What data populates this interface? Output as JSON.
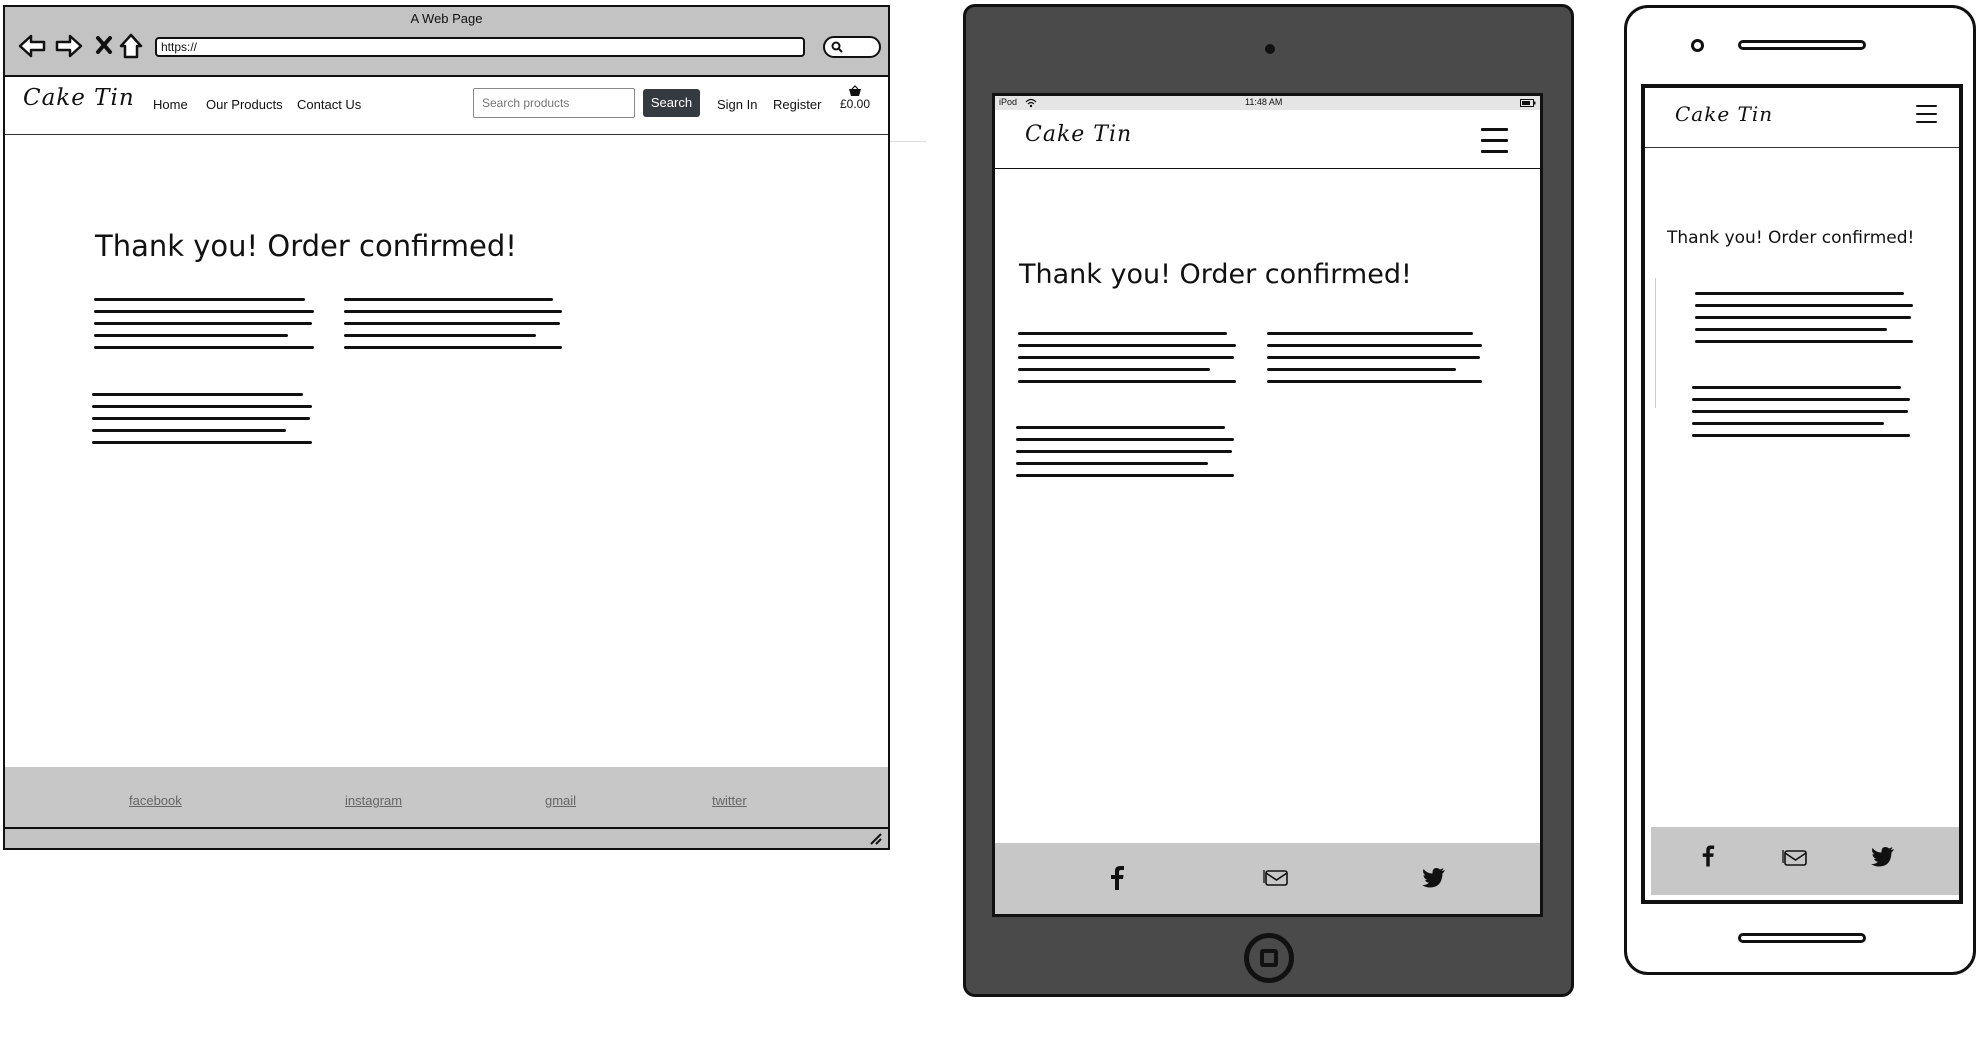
{
  "desktop": {
    "window_title": "A Web Page",
    "url": "https://",
    "brand": "Cake Tin",
    "nav": [
      "Home",
      "Our Products",
      "Contact Us"
    ],
    "search_placeholder": "Search products",
    "search_button": "Search",
    "sign_in": "Sign In",
    "register": "Register",
    "cart_total": "£0.00",
    "heading": "Thank you! Order confirmed!",
    "footer_links": [
      "facebook",
      "instagram",
      "gmail",
      "twitter"
    ]
  },
  "tablet": {
    "status_device": "iPod",
    "status_time": "11:48 AM",
    "brand": "Cake Tin",
    "heading": "Thank you! Order confirmed!"
  },
  "phone": {
    "brand": "Cake Tin",
    "heading": "Thank you! Order confirmed!"
  },
  "icons": {
    "back": "arrow-left-icon",
    "forward": "arrow-right-icon",
    "stop": "close-icon",
    "home": "home-icon",
    "search": "search-icon",
    "cart": "basket-icon",
    "menu": "hamburger-icon",
    "facebook": "facebook-icon",
    "mail": "mail-icon",
    "twitter": "twitter-icon"
  }
}
